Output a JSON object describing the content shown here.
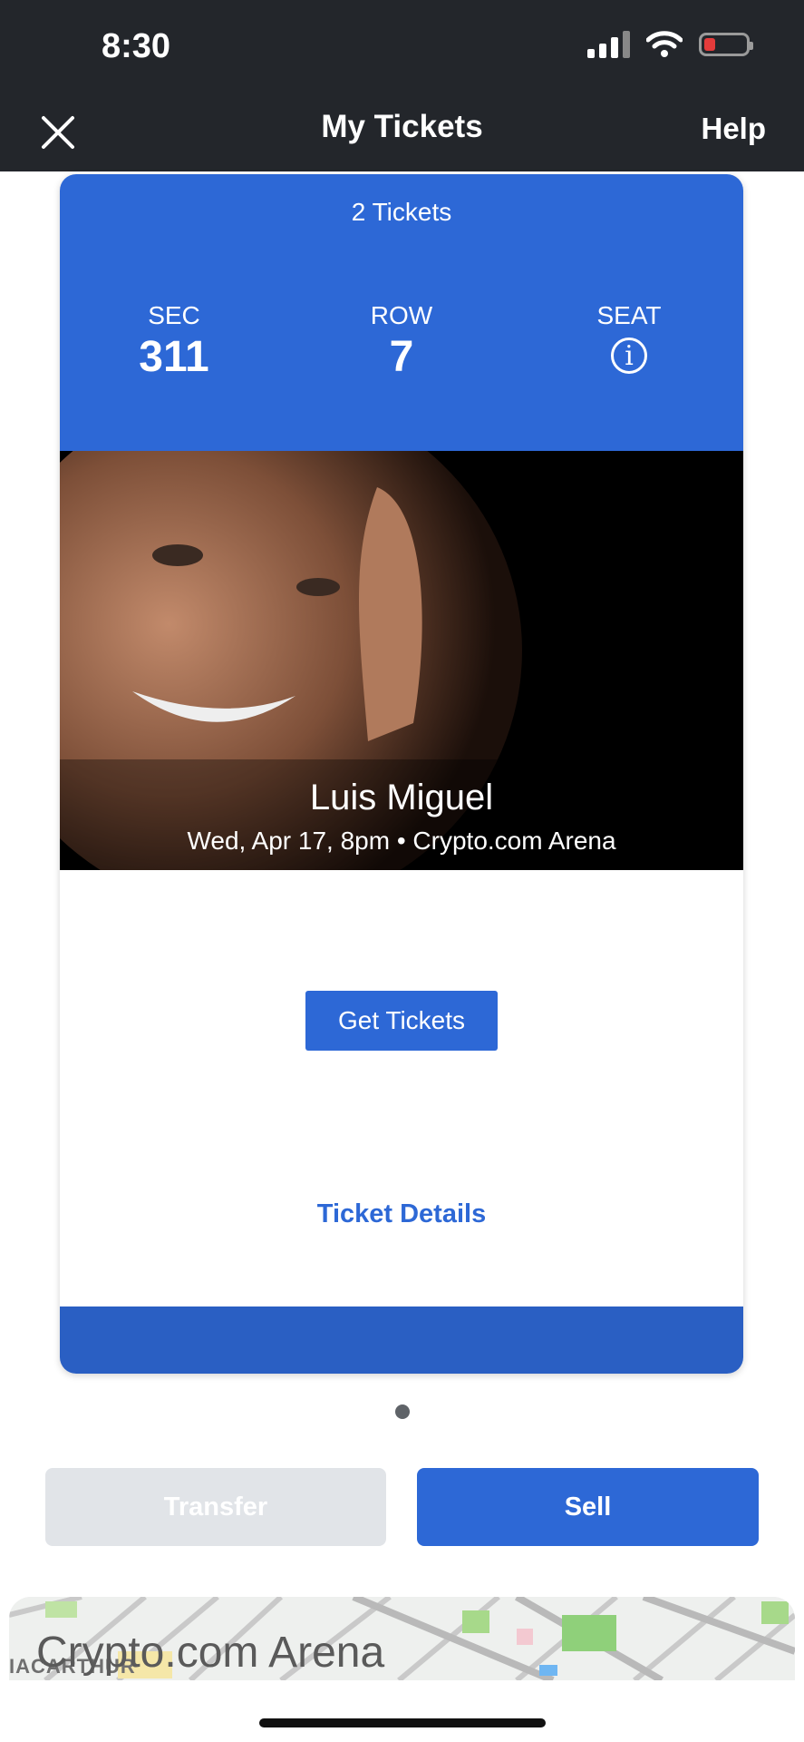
{
  "status_bar": {
    "time": "8:30"
  },
  "header": {
    "title": "My Tickets",
    "help": "Help"
  },
  "ticket": {
    "count_label": "2 Tickets",
    "section": {
      "label": "SEC",
      "value": "311"
    },
    "row": {
      "label": "ROW",
      "value": "7"
    },
    "seat": {
      "label": "SEAT",
      "icon": "info-icon"
    },
    "event": {
      "name": "Luis Miguel",
      "details": "Wed, Apr 17, 8pm • Crypto.com Arena"
    },
    "get_tickets": "Get Tickets",
    "ticket_details": "Ticket Details"
  },
  "actions": {
    "transfer": "Transfer",
    "sell": "Sell"
  },
  "map": {
    "venue": "Crypto.com Arena",
    "street_fragment": "IACARTHUR"
  },
  "colors": {
    "primary": "#2d68d6",
    "header_bg": "#23262b",
    "disabled": "#e1e4e8"
  }
}
